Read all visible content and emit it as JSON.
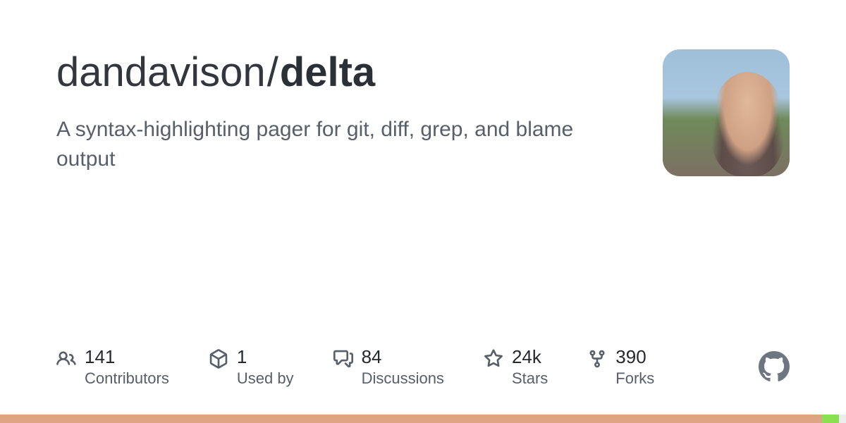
{
  "repo": {
    "owner": "dandavison",
    "separator": "/",
    "name": "delta",
    "description": "A syntax-highlighting pager for git, diff, grep, and blame output"
  },
  "stats": {
    "contributors": {
      "value": "141",
      "label": "Contributors"
    },
    "usedby": {
      "value": "1",
      "label": "Used by"
    },
    "discussions": {
      "value": "84",
      "label": "Discussions"
    },
    "stars": {
      "value": "24k",
      "label": "Stars"
    },
    "forks": {
      "value": "390",
      "label": "Forks"
    }
  },
  "languages": [
    {
      "color": "#dea584",
      "percent": 97.2
    },
    {
      "color": "#89e051",
      "percent": 2.0
    },
    {
      "color": "#ededed",
      "percent": 0.8
    }
  ]
}
